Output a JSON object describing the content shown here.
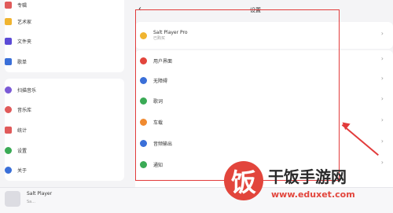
{
  "sidebar": {
    "top_items": [
      {
        "label": "专辑",
        "icon": "album-icon",
        "color": "#e05a5a"
      },
      {
        "label": "艺术家",
        "icon": "pen-icon",
        "color": "#f0b430"
      },
      {
        "label": "文件夹",
        "icon": "folder-icon",
        "color": "#5b4bd6"
      },
      {
        "label": "歌单",
        "icon": "playlist-icon",
        "color": "#3a6fd8"
      }
    ],
    "bottom_items": [
      {
        "label": "扫描音乐",
        "icon": "scan-icon",
        "color": "#7b5ad6"
      },
      {
        "label": "音乐库",
        "icon": "library-icon",
        "color": "#e05a5a"
      },
      {
        "label": "统计",
        "icon": "stats-icon",
        "color": "#e05a5a"
      },
      {
        "label": "设置",
        "icon": "gear-icon",
        "color": "#3aaa55"
      },
      {
        "label": "关于",
        "icon": "info-icon",
        "color": "#3a6fd8"
      }
    ]
  },
  "header": {
    "back_icon": "back-arrow-icon",
    "title": "设置"
  },
  "pro": {
    "name": "Salt Player Pro",
    "status": "已购买",
    "icon": "star-icon",
    "color": "#f0b430"
  },
  "settings": [
    {
      "label": "用户界面",
      "icon": "palette-icon",
      "color": "#e2453c"
    },
    {
      "label": "无障碍",
      "icon": "accessibility-icon",
      "color": "#3a6fd8"
    },
    {
      "label": "歌词",
      "icon": "lyrics-icon",
      "color": "#3aaa55"
    },
    {
      "label": "车载",
      "icon": "car-icon",
      "color": "#f08a30"
    },
    {
      "label": "音频输出",
      "icon": "speaker-icon",
      "color": "#3a6fd8"
    },
    {
      "label": "通知",
      "icon": "bell-icon",
      "color": "#3aaa55"
    }
  ],
  "player": {
    "title": "Salt Player",
    "subtitle": "Sa..."
  },
  "watermark": {
    "logo_char": "饭",
    "text": "干饭手游网",
    "url": "www.eduxet.com"
  }
}
